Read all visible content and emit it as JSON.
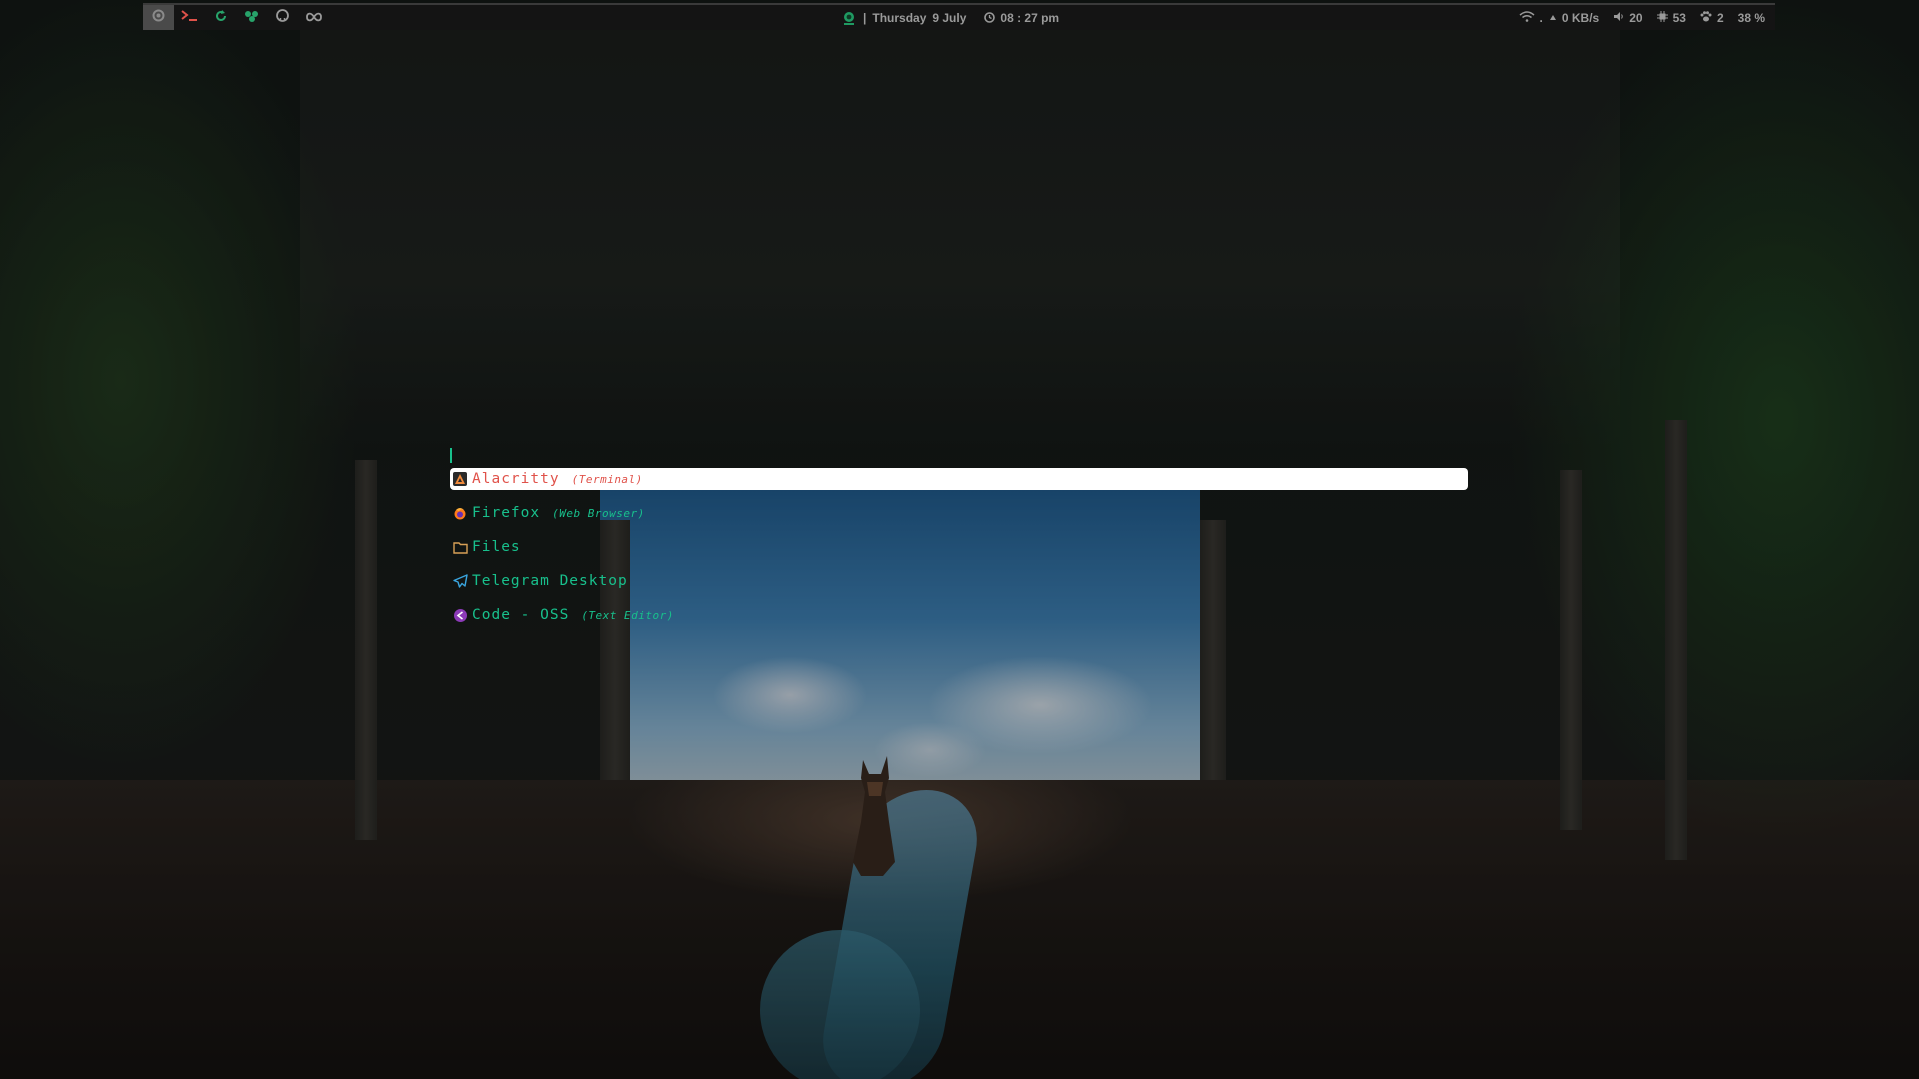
{
  "colors": {
    "accent": "#18c08c",
    "selected_text": "#e0524a",
    "selected_bg": "#ffffff",
    "bar_bg": "#141414",
    "bar_text": "#9a9a9a"
  },
  "topbar": {
    "left_icons": [
      "menu-icon",
      "terminal-icon",
      "refresh-icon",
      "flower-icon",
      "github-icon",
      "infinity-icon"
    ],
    "date_separator": "|",
    "day": "Thursday",
    "date": "9 July",
    "time": "08 : 27 pm",
    "network_speed": "0 KB/s",
    "volume": "20",
    "cpu": "53",
    "updates": "2",
    "battery": "38 %"
  },
  "launcher": {
    "input_value": "",
    "entries": [
      {
        "name": "Alacritty",
        "comment": "(Terminal)",
        "icon": "alacritty-icon",
        "selected": true
      },
      {
        "name": "Firefox",
        "comment": "(Web Browser)",
        "icon": "firefox-icon",
        "selected": false
      },
      {
        "name": "Files",
        "comment": "",
        "icon": "folder-icon",
        "selected": false
      },
      {
        "name": "Telegram Desktop",
        "comment": "",
        "icon": "telegram-icon",
        "selected": false
      },
      {
        "name": "Code - OSS",
        "comment": "(Text Editor)",
        "icon": "code-oss-icon",
        "selected": false
      }
    ]
  }
}
